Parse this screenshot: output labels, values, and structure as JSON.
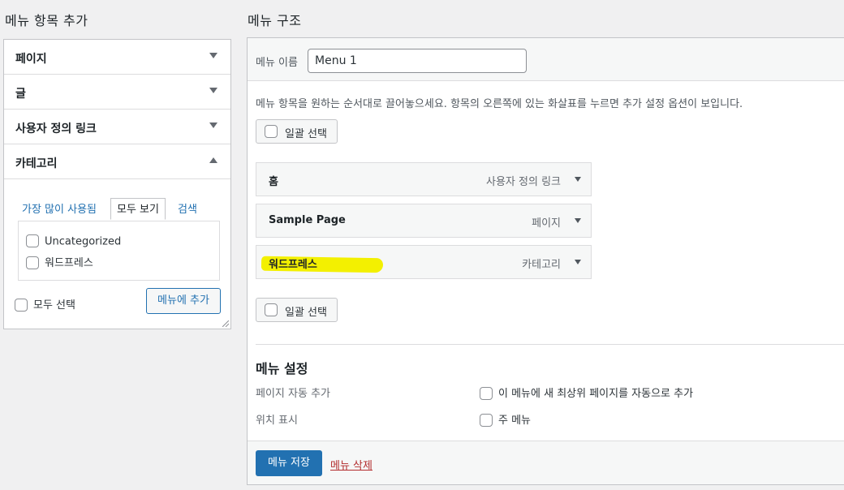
{
  "left": {
    "title": "메뉴 항목 추가",
    "sections": [
      {
        "label": "페이지"
      },
      {
        "label": "글"
      },
      {
        "label": "사용자 정의 링크"
      },
      {
        "label": "카테고리"
      }
    ],
    "tabs": [
      "가장 많이 사용됨",
      "모두 보기",
      "검색"
    ],
    "categories": [
      "Uncategorized",
      "워드프레스"
    ],
    "select_all": "모두 선택",
    "add_button": "메뉴에 추가"
  },
  "right": {
    "title": "메뉴 구조",
    "name_label": "메뉴 이름",
    "name_value": "Menu 1",
    "instructions": "메뉴 항목을 원하는 순서대로 끌어놓으세요. 항목의 오른쪽에 있는 화살표를 누르면 추가 설정 옵션이 보입니다.",
    "bulk_select": "일괄 선택",
    "items": [
      {
        "title": "홈",
        "type": "사용자 정의 링크"
      },
      {
        "title": "Sample Page",
        "type": "페이지"
      },
      {
        "title": "워드프레스",
        "type": "카테고리"
      }
    ],
    "settings": {
      "heading": "메뉴 설정",
      "auto_add_label": "페이지 자동 추가",
      "auto_add_option": "이 메뉴에 새 최상위 페이지를 자동으로 추가",
      "location_label": "위치 표시",
      "location_option": "주 메뉴"
    },
    "save_button": "메뉴 저장",
    "delete_link": "메뉴 삭제"
  },
  "colors": {
    "accent": "#2271b1",
    "delete": "#b32d2e",
    "highlight": "#f3f000"
  }
}
